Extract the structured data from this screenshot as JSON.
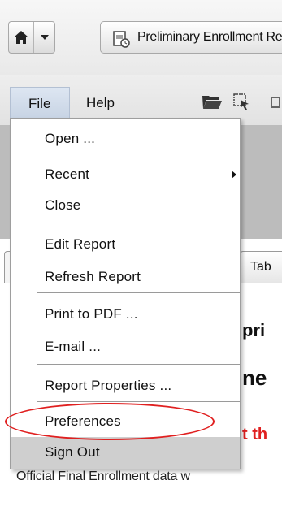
{
  "toolbar": {
    "report_tab_label": "Preliminary Enrollment Report"
  },
  "menubar": {
    "file_label": "File",
    "help_label": "Help"
  },
  "file_menu": {
    "open": "Open ...",
    "recent": "Recent",
    "close": "Close",
    "edit_report": "Edit Report",
    "refresh_report": "Refresh Report",
    "print_pdf": "Print to PDF ...",
    "email": "E-mail ...",
    "report_properties": "Report Properties ...",
    "preferences": "Preferences",
    "sign_out": "Sign Out"
  },
  "background": {
    "table_tab": "Tab",
    "heading_1": "pri",
    "heading_2": "ne",
    "red_text": "t th",
    "footer_text": "Official Final Enrollment data w"
  },
  "colors": {
    "annotation_red": "#e02020",
    "menu_highlight": "#cfcfcf",
    "file_menu_active": "#c8d4e4"
  }
}
